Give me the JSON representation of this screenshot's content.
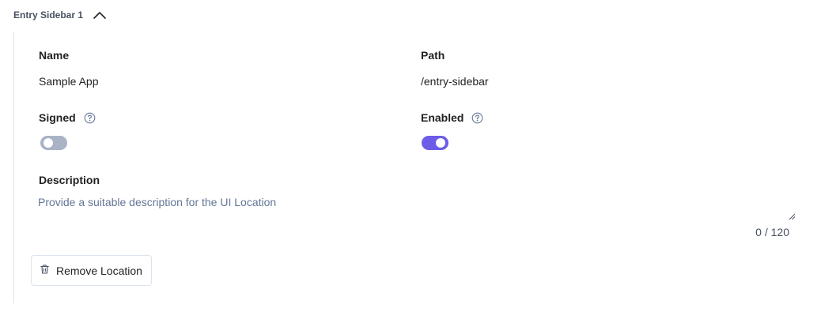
{
  "section": {
    "title": "Entry Sidebar 1",
    "toggle_icon": "chevron-up-icon"
  },
  "fields": {
    "name": {
      "label": "Name",
      "value": "Sample App"
    },
    "path": {
      "label": "Path",
      "value": "/entry-sidebar"
    },
    "signed": {
      "label": "Signed",
      "help_icon": "question-circle-icon",
      "enabled": false
    },
    "enabled": {
      "label": "Enabled",
      "help_icon": "question-circle-icon",
      "enabled": true
    },
    "description": {
      "label": "Description",
      "value": "",
      "placeholder": "Provide a suitable description for the UI Location",
      "char_count": "0 / 120"
    }
  },
  "actions": {
    "remove": {
      "label": "Remove Location",
      "icon": "trash-icon"
    }
  },
  "colors": {
    "accent": "#6c5ce7",
    "toggle_off": "#a9b3c5",
    "border": "#dde3ee",
    "placeholder": "#647696"
  }
}
